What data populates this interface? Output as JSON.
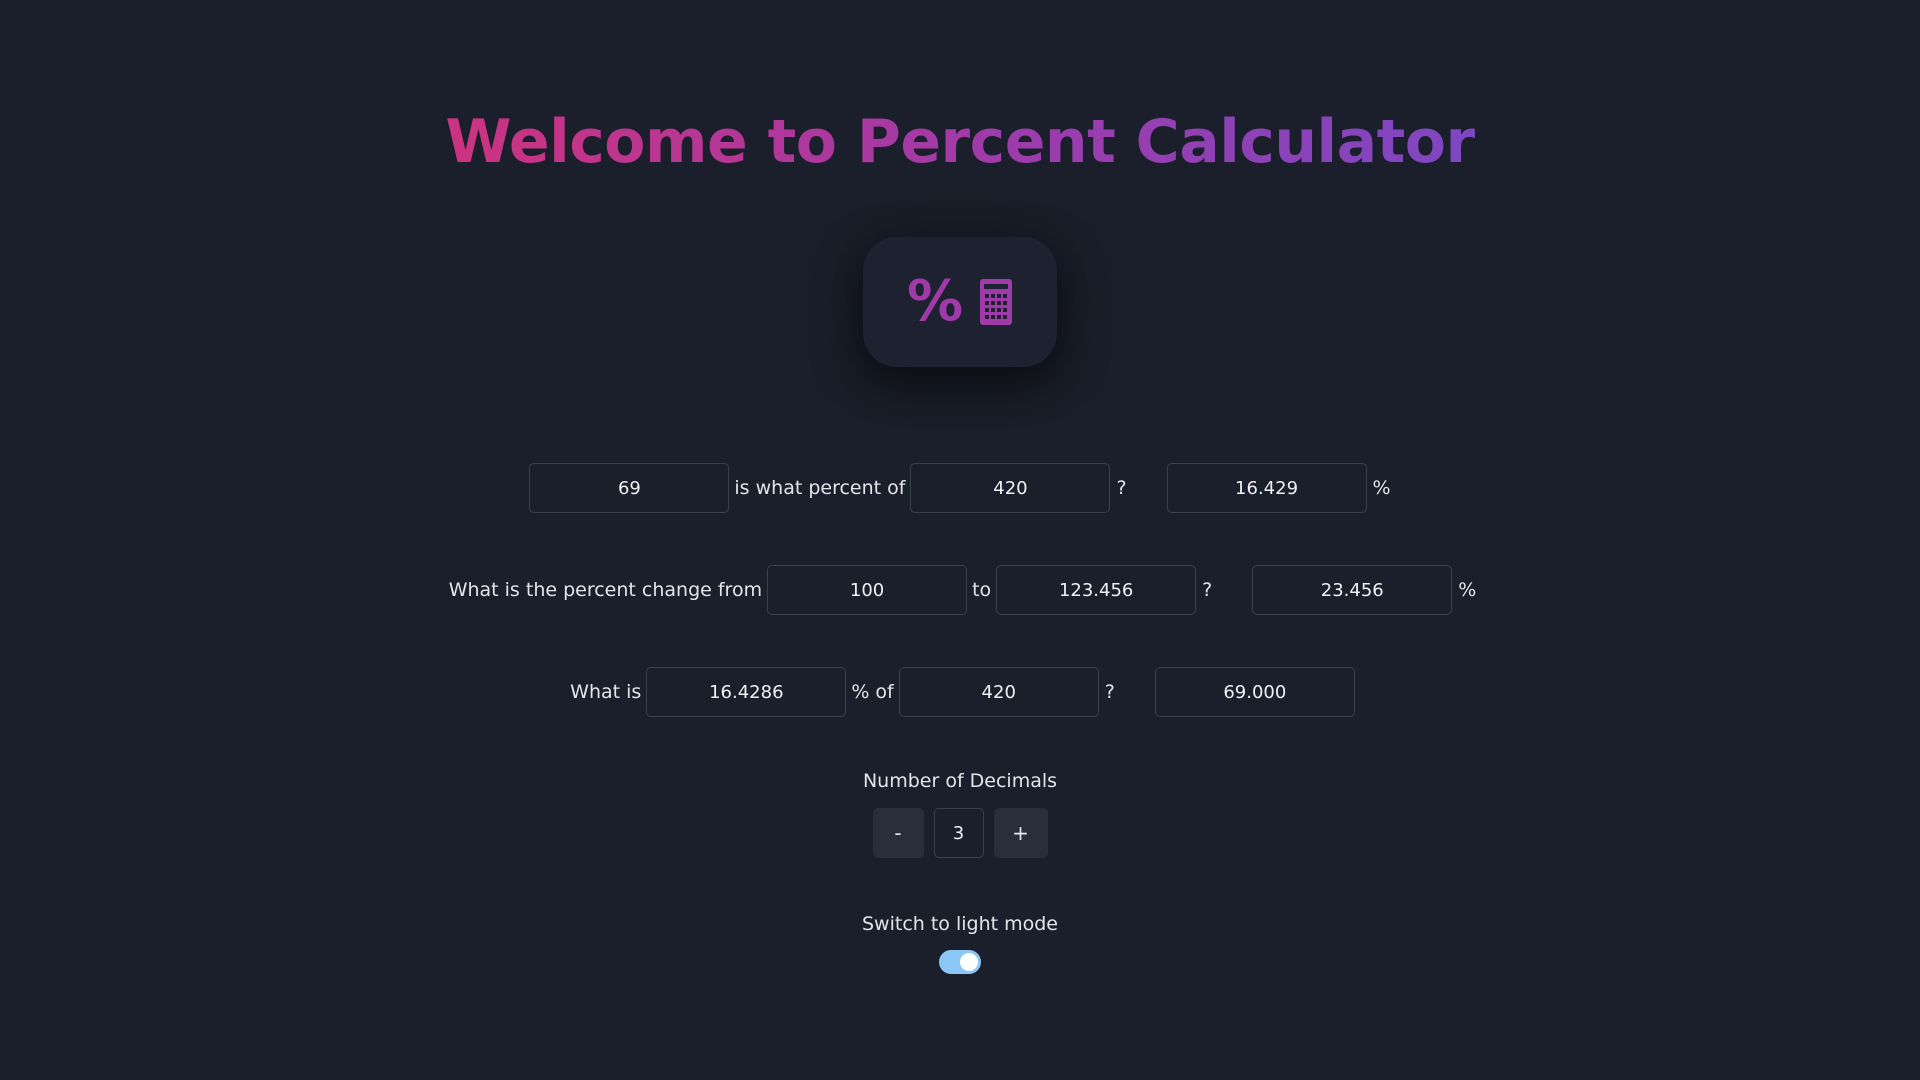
{
  "title": "Welcome to Percent Calculator",
  "logo": {
    "percent_glyph": "%",
    "icon": "calculator-icon",
    "accent_color": "#a13aa9"
  },
  "calc1": {
    "value_a": "69",
    "text_mid": "is what percent of",
    "value_b": "420",
    "question": "?",
    "result": "16.429",
    "suffix": "%"
  },
  "calc2": {
    "text_start": "What is the percent change from",
    "value_from": "100",
    "text_to": "to",
    "value_to": "123.456",
    "question": "?",
    "result": "23.456",
    "suffix": "%"
  },
  "calc3": {
    "text_start": "What is",
    "value_pct": "16.4286",
    "text_of": "% of",
    "value_base": "420",
    "question": "?",
    "result": "69.000"
  },
  "decimals": {
    "label": "Number of Decimals",
    "minus_label": "-",
    "value": "3",
    "plus_label": "+"
  },
  "theme": {
    "label": "Switch to light mode",
    "toggle_on": true,
    "toggle_color": "#8cc6f4"
  },
  "colors": {
    "background": "#1b1f2b",
    "title_gradient_start": "#cc3380",
    "title_gradient_end": "#7e47c2"
  }
}
